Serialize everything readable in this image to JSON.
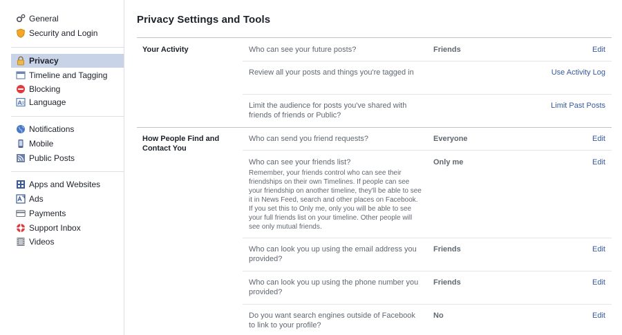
{
  "sidebar": {
    "groups": [
      [
        {
          "label": "General",
          "icon": "gears-icon"
        },
        {
          "label": "Security and Login",
          "icon": "shield-icon"
        }
      ],
      [
        {
          "label": "Privacy",
          "icon": "lock-icon",
          "active": true
        },
        {
          "label": "Timeline and Tagging",
          "icon": "timeline-icon"
        },
        {
          "label": "Blocking",
          "icon": "block-icon"
        },
        {
          "label": "Language",
          "icon": "language-icon"
        }
      ],
      [
        {
          "label": "Notifications",
          "icon": "globe-icon"
        },
        {
          "label": "Mobile",
          "icon": "mobile-icon"
        },
        {
          "label": "Public Posts",
          "icon": "rss-icon"
        }
      ],
      [
        {
          "label": "Apps and Websites",
          "icon": "apps-icon"
        },
        {
          "label": "Ads",
          "icon": "ads-icon"
        },
        {
          "label": "Payments",
          "icon": "card-icon"
        },
        {
          "label": "Support Inbox",
          "icon": "lifebuoy-icon"
        },
        {
          "label": "Videos",
          "icon": "film-icon"
        }
      ]
    ]
  },
  "main": {
    "title": "Privacy Settings and Tools",
    "sections": [
      {
        "label": "Your Activity",
        "rows": [
          {
            "question": "Who can see your future posts?",
            "value": "Friends",
            "action": "Edit"
          },
          {
            "question": "Review all your posts and things you're tagged in",
            "value": "",
            "action": "Use Activity Log"
          },
          {
            "question": "Limit the audience for posts you've shared with friends of friends or Public?",
            "value": "",
            "action": "Limit Past Posts"
          }
        ]
      },
      {
        "label": "How People Find and Contact You",
        "rows": [
          {
            "question": "Who can send you friend requests?",
            "value": "Everyone",
            "action": "Edit"
          },
          {
            "question": "Who can see your friends list?",
            "description": "Remember, your friends control who can see their friendships on their own Timelines. If people can see your friendship on another timeline, they'll be able to see it in News Feed, search and other places on Facebook. If you set this to Only me, only you will be able to see your full friends list on your timeline. Other people will see only mutual friends.",
            "value": "Only me",
            "action": "Edit"
          },
          {
            "question": "Who can look you up using the email address you provided?",
            "value": "Friends",
            "action": "Edit"
          },
          {
            "question": "Who can look you up using the phone number you provided?",
            "value": "Friends",
            "action": "Edit"
          },
          {
            "question": "Do you want search engines outside of Facebook to link to your profile?",
            "value": "No",
            "action": "Edit"
          }
        ]
      }
    ]
  },
  "colors": {
    "link": "#365899",
    "active_bg": "#c9d3e8",
    "muted_text": "#606770"
  }
}
